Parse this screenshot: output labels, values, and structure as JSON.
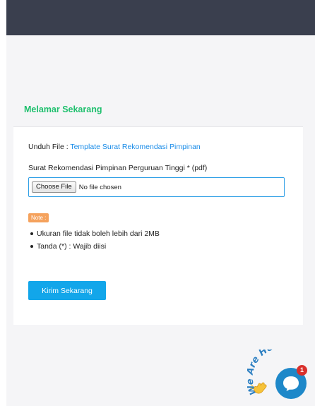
{
  "section_title": "Melamar Sekarang",
  "download": {
    "prefix": "Unduh File : ",
    "link_label": "Template Surat Rekomendasi Pimpinan"
  },
  "upload": {
    "label": "Surat Rekomendasi Pimpinan Perguruan Tinggi * (pdf)",
    "button_label": "Choose File",
    "status": "No file chosen"
  },
  "note": {
    "badge": "Note :",
    "items": [
      "Ukuran file tidak boleh lebih dari 2MB",
      "Tanda (*) : Wajib diisi"
    ]
  },
  "submit_label": "Kirim Sekarang",
  "chat": {
    "tagline": "We Are Here!",
    "unread_count": "1"
  },
  "colors": {
    "header_bg": "#3a3f4e",
    "title_green": "#1fc06e",
    "link_blue": "#1a8ce8",
    "button_blue": "#12a6ea",
    "note_orange": "#f5a25d",
    "chat_blue": "#1e88c9",
    "badge_red": "#d9302c"
  }
}
